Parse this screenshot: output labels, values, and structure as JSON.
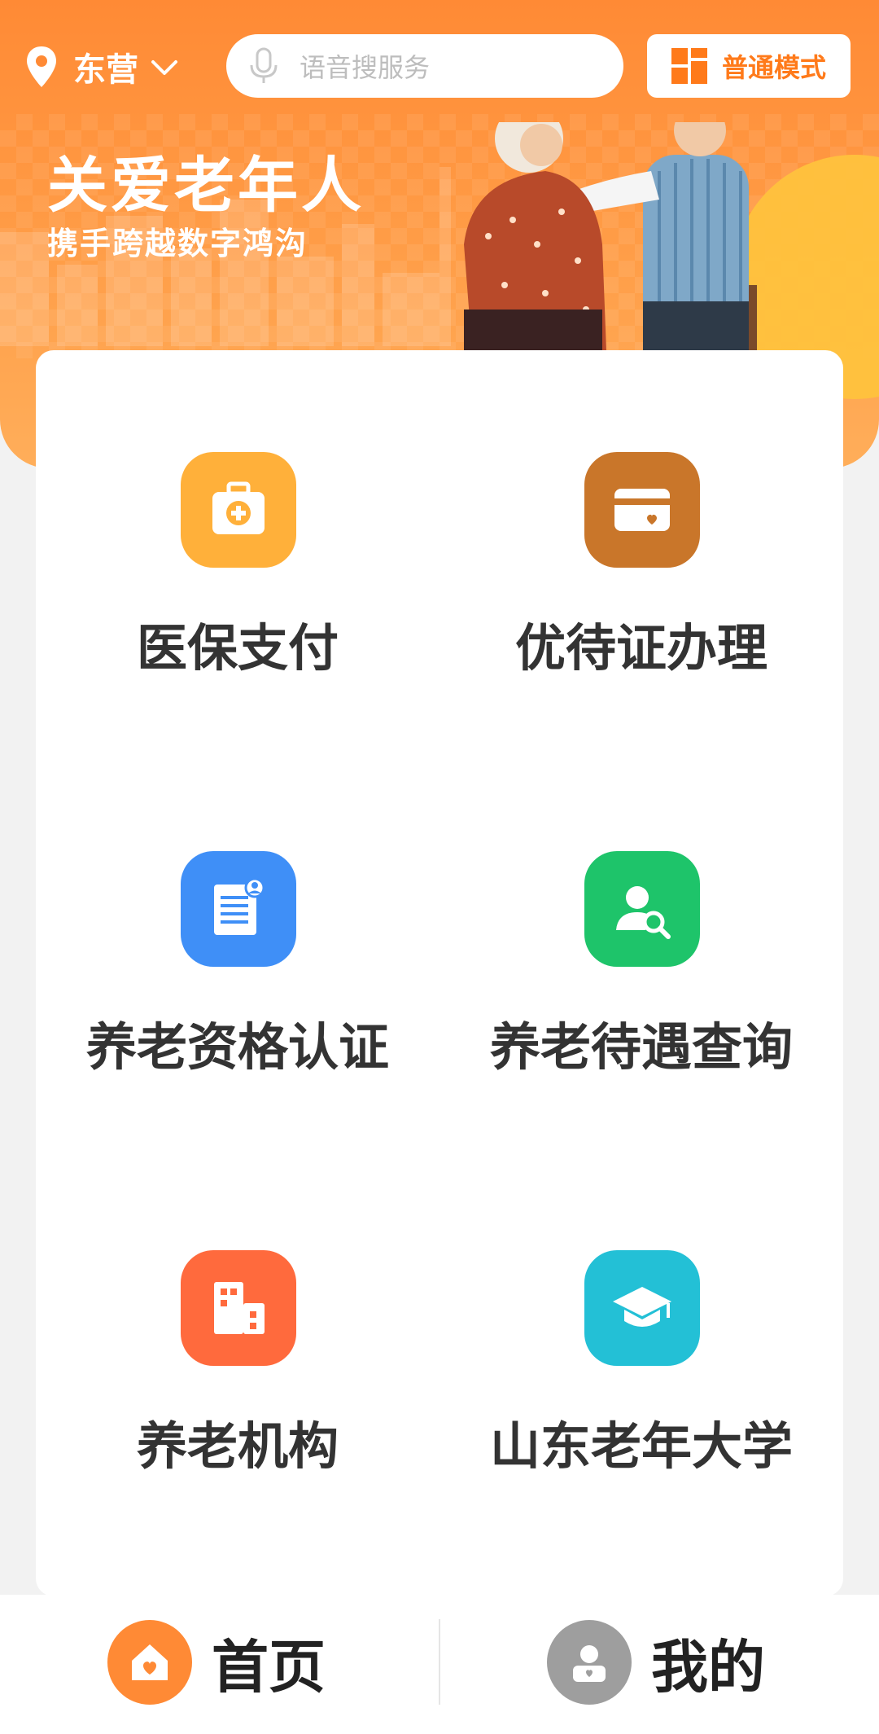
{
  "header": {
    "city": "东营",
    "search_placeholder": "语音搜服务",
    "mode_label": "普通模式"
  },
  "banner": {
    "title": "关爱老年人",
    "subtitle": "携手跨越数字鸿沟"
  },
  "services": [
    {
      "label": "医保支付",
      "icon": "medical-kit-icon",
      "color": "#ffb03a"
    },
    {
      "label": "优待证办理",
      "icon": "card-heart-icon",
      "color": "#c9762a"
    },
    {
      "label": "养老资格认证",
      "icon": "document-user-icon",
      "color": "#3f8ff7"
    },
    {
      "label": "养老待遇查询",
      "icon": "user-search-icon",
      "color": "#1ec46a"
    },
    {
      "label": "养老机构",
      "icon": "building-icon",
      "color": "#ff6a3d"
    },
    {
      "label": "山东老年大学",
      "icon": "graduation-cap-icon",
      "color": "#23c0d6"
    }
  ],
  "tabbar": {
    "home_label": "首页",
    "mine_label": "我的"
  },
  "colors": {
    "brand_orange": "#ff8a35",
    "home_active": "#ff8a35",
    "mine_inactive": "#9e9e9e"
  }
}
